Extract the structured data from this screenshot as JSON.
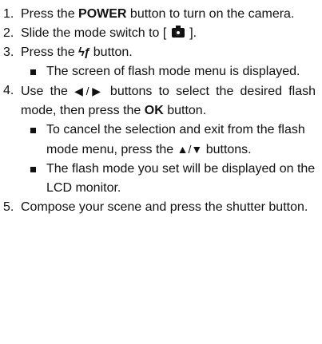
{
  "steps": [
    {
      "num": "1.",
      "pre": "Press the ",
      "bold": "POWER",
      "post": " button to turn on the camera."
    },
    {
      "num": "2.",
      "pre": "Slide the mode switch to [",
      "icon": "camera-icon",
      "post": "]."
    },
    {
      "num": "3.",
      "pre": "Press the ",
      "icon": "flash-icon",
      "icon_glyph": "ϟƒ",
      "post": " button.",
      "bullets": [
        {
          "text": "The screen of flash mode menu is displayed."
        }
      ]
    },
    {
      "num": "4.",
      "pre": "Use the ",
      "arrows": "◀/▶",
      "mid": " buttons to select the desired flash mode, then press the ",
      "bold": "OK",
      "post": " button.",
      "bullets": [
        {
          "pre": "To cancel the selection and exit from the flash mode menu, press the ",
          "arrows": "▲/▼",
          "post": " buttons."
        },
        {
          "text": "The flash mode you set will be displayed on the LCD monitor."
        }
      ]
    },
    {
      "num": "5.",
      "text": "Compose your scene and press the shutter button."
    }
  ]
}
